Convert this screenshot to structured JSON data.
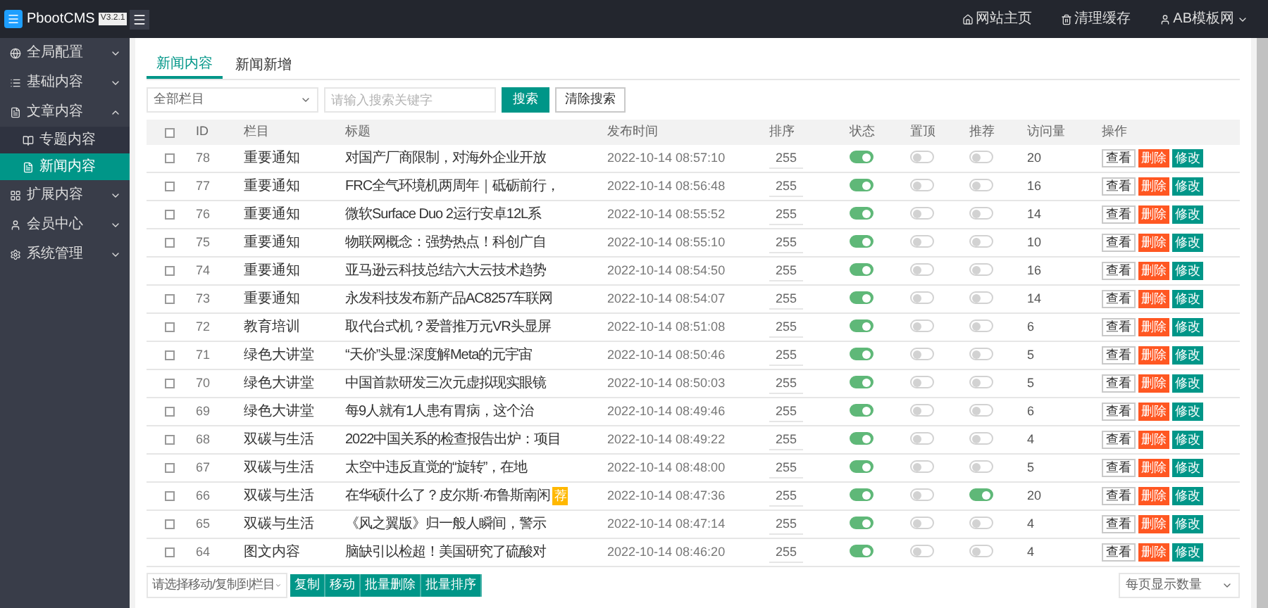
{
  "header": {
    "brand": "PbootCMS",
    "version": "V3.2.1",
    "links": [
      {
        "kind": "home",
        "label": "网站主页"
      },
      {
        "kind": "cache",
        "label": "清理缓存"
      },
      {
        "kind": "user",
        "label": "AB模板网"
      }
    ]
  },
  "sidebar": {
    "items": [
      {
        "label": "全局配置",
        "expanded": false,
        "selected": false
      },
      {
        "label": "基础内容",
        "expanded": false,
        "selected": false
      },
      {
        "label": "文章内容",
        "expanded": true,
        "selected": false,
        "children": [
          {
            "label": "专题内容",
            "selected": false
          },
          {
            "label": "新闻内容",
            "selected": true
          }
        ]
      },
      {
        "label": "扩展内容",
        "expanded": false,
        "selected": false
      },
      {
        "label": "会员中心",
        "expanded": false,
        "selected": false
      },
      {
        "label": "系统管理",
        "expanded": false,
        "selected": false
      }
    ]
  },
  "tabs": [
    {
      "label": "新闻内容",
      "selected": true
    },
    {
      "label": "新闻新增",
      "selected": false
    }
  ],
  "search": {
    "category": "全部栏目",
    "placeholder": "请输入搜索关键字",
    "search_button": "搜索",
    "clear_button": "清除搜索"
  },
  "table": {
    "select_all_checked": false,
    "columns": [
      "ID",
      "栏目",
      "标题",
      "发布时间",
      "排序",
      "状态",
      "置顶",
      "推荐",
      "访问量",
      "操作"
    ],
    "rows": [
      {
        "id": "78",
        "category": "重要通知",
        "title": "对国产厂商限制，对海外企业开放",
        "time": "2022-10-14 08:57:10",
        "sort": "255",
        "status": true,
        "top": false,
        "recommend": false,
        "visits": "20",
        "checked": false,
        "actions": [
          "查看",
          "删除",
          "修改"
        ]
      },
      {
        "id": "77",
        "category": "重要通知",
        "title": "FRC全气环境机两周年｜砥砺前行，",
        "time": "2022-10-14 08:56:48",
        "sort": "255",
        "status": true,
        "top": false,
        "recommend": false,
        "visits": "16",
        "checked": false,
        "actions": [
          "查看",
          "删除",
          "修改"
        ]
      },
      {
        "id": "76",
        "category": "重要通知",
        "title": "微软Surface Duo 2运行安卓12L系",
        "time": "2022-10-14 08:55:52",
        "sort": "255",
        "status": true,
        "top": false,
        "recommend": false,
        "visits": "14",
        "checked": false,
        "actions": [
          "查看",
          "删除",
          "修改"
        ]
      },
      {
        "id": "75",
        "category": "重要通知",
        "title": "物联网概念：强势热点！科创广自",
        "time": "2022-10-14 08:55:10",
        "sort": "255",
        "status": true,
        "top": false,
        "recommend": false,
        "visits": "10",
        "checked": false,
        "actions": [
          "查看",
          "删除",
          "修改"
        ]
      },
      {
        "id": "74",
        "category": "重要通知",
        "title": "亚马逊云科技总结六大云技术趋势",
        "time": "2022-10-14 08:54:50",
        "sort": "255",
        "status": true,
        "top": false,
        "recommend": false,
        "visits": "16",
        "checked": false,
        "actions": [
          "查看",
          "删除",
          "修改"
        ]
      },
      {
        "id": "73",
        "category": "重要通知",
        "title": "永发科技发布新产品AC8257车联网",
        "time": "2022-10-14 08:54:07",
        "sort": "255",
        "status": true,
        "top": false,
        "recommend": false,
        "visits": "14",
        "checked": false,
        "actions": [
          "查看",
          "删除",
          "修改"
        ]
      },
      {
        "id": "72",
        "category": "教育培训",
        "title": "取代台式机？爱普推万元VR头显屏",
        "time": "2022-10-14 08:51:08",
        "sort": "255",
        "status": true,
        "top": false,
        "recommend": false,
        "visits": "6",
        "checked": false,
        "actions": [
          "查看",
          "删除",
          "修改"
        ]
      },
      {
        "id": "71",
        "category": "绿色大讲堂",
        "title": "“天价”头显:深度解Meta的元宇宙",
        "time": "2022-10-14 08:50:46",
        "sort": "255",
        "status": true,
        "top": false,
        "recommend": false,
        "visits": "5",
        "checked": false,
        "actions": [
          "查看",
          "删除",
          "修改"
        ]
      },
      {
        "id": "70",
        "category": "绿色大讲堂",
        "title": "中国首款研发三次元虚拟现实眼镜",
        "time": "2022-10-14 08:50:03",
        "sort": "255",
        "status": true,
        "top": false,
        "recommend": false,
        "visits": "5",
        "checked": false,
        "actions": [
          "查看",
          "删除",
          "修改"
        ]
      },
      {
        "id": "69",
        "category": "绿色大讲堂",
        "title": "每9人就有1人患有胃病，这个治",
        "time": "2022-10-14 08:49:46",
        "sort": "255",
        "status": true,
        "top": false,
        "recommend": false,
        "visits": "6",
        "checked": false,
        "actions": [
          "查看",
          "删除",
          "修改"
        ]
      },
      {
        "id": "68",
        "category": "双碳与生活",
        "title": "2022中国关系的检查报告出炉：项目",
        "time": "2022-10-14 08:49:22",
        "sort": "255",
        "status": true,
        "top": false,
        "recommend": false,
        "visits": "4",
        "checked": false,
        "actions": [
          "查看",
          "删除",
          "修改"
        ]
      },
      {
        "id": "67",
        "category": "双碳与生活",
        "title": "太空中违反直觉的“旋转”，在地",
        "time": "2022-10-14 08:48:00",
        "sort": "255",
        "status": true,
        "top": false,
        "recommend": false,
        "visits": "5",
        "checked": false,
        "actions": [
          "查看",
          "删除",
          "修改"
        ]
      },
      {
        "id": "66",
        "category": "双碳与生活",
        "title": "在华硕什么了？皮尔斯·布鲁斯南闲",
        "badge": "荐",
        "time": "2022-10-14 08:47:36",
        "sort": "255",
        "status": true,
        "top": false,
        "recommend": true,
        "visits": "20",
        "checked": false,
        "actions": [
          "查看",
          "删除",
          "修改"
        ]
      },
      {
        "id": "65",
        "category": "双碳与生活",
        "title": "《风之翼版》归一般人瞬间，警示",
        "time": "2022-10-14 08:47:14",
        "sort": "255",
        "status": true,
        "top": false,
        "recommend": false,
        "visits": "4",
        "checked": false,
        "actions": [
          "查看",
          "删除",
          "修改"
        ]
      },
      {
        "id": "64",
        "category": "图文内容",
        "title": "脑缺引以检超！美国研究了硫酸对",
        "time": "2022-10-14 08:46:20",
        "sort": "255",
        "status": true,
        "top": false,
        "recommend": false,
        "visits": "4",
        "checked": false,
        "actions": [
          "查看",
          "删除",
          "修改"
        ]
      }
    ]
  },
  "footer": {
    "move_select": "请选择移动/复制到栏目",
    "buttons": [
      "复制",
      "移动",
      "批量删除",
      "批量排序"
    ],
    "page_size": "每页显示数量"
  }
}
